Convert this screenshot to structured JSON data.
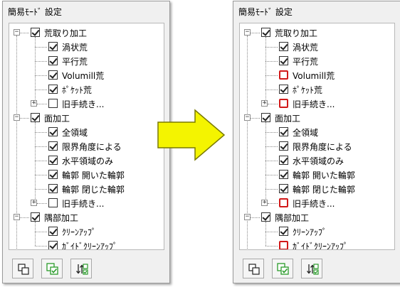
{
  "left_panel": {
    "title": "簡易ﾓｰﾄﾞ 設定",
    "groups": [
      {
        "label": "荒取り加工",
        "checked": true,
        "items": [
          {
            "label": "渦状荒",
            "checked": true
          },
          {
            "label": "平行荒",
            "checked": true
          },
          {
            "label": "Volumill荒",
            "checked": true
          },
          {
            "label": "ﾎﾟｹｯﾄ荒",
            "checked": true
          },
          {
            "label": "旧手続き...",
            "checked": false,
            "collapsed": true
          }
        ]
      },
      {
        "label": "面加工",
        "checked": true,
        "items": [
          {
            "label": "全領域",
            "checked": true
          },
          {
            "label": "限界角度による",
            "checked": true
          },
          {
            "label": "水平領域のみ",
            "checked": true
          },
          {
            "label": "輪郭 開いた輪郭",
            "checked": true
          },
          {
            "label": "輪郭 閉じた輪郭",
            "checked": true
          },
          {
            "label": "旧手続き...",
            "checked": false,
            "collapsed": true
          }
        ]
      },
      {
        "label": "隅部加工",
        "checked": true,
        "items": [
          {
            "label": "ｸﾘｰﾝｱｯﾌﾟ",
            "checked": true
          },
          {
            "label": "ｶﾞｲﾄﾞｸﾘｰﾝｱｯﾌﾟ",
            "checked": true
          }
        ]
      }
    ]
  },
  "right_panel": {
    "title": "簡易ﾓｰﾄﾞ 設定",
    "groups": [
      {
        "label": "荒取り加工",
        "checked": true,
        "items": [
          {
            "label": "渦状荒",
            "checked": true
          },
          {
            "label": "平行荒",
            "checked": true
          },
          {
            "label": "Volumill荒",
            "checked": false,
            "highlight": true
          },
          {
            "label": "ﾎﾟｹｯﾄ荒",
            "checked": true
          },
          {
            "label": "旧手続き...",
            "checked": false,
            "highlight": true,
            "collapsed": true
          }
        ]
      },
      {
        "label": "面加工",
        "checked": true,
        "items": [
          {
            "label": "全領域",
            "checked": true
          },
          {
            "label": "限界角度による",
            "checked": true
          },
          {
            "label": "水平領域のみ",
            "checked": true
          },
          {
            "label": "輪郭 開いた輪郭",
            "checked": true
          },
          {
            "label": "輪郭 閉じた輪郭",
            "checked": true
          },
          {
            "label": "旧手続き...",
            "checked": false,
            "highlight": true,
            "collapsed": true
          }
        ]
      },
      {
        "label": "隅部加工",
        "checked": true,
        "items": [
          {
            "label": "ｸﾘｰﾝｱｯﾌﾟ",
            "checked": true
          },
          {
            "label": "ｶﾞｲﾄﾞｸﾘｰﾝｱｯﾌﾟ",
            "checked": false,
            "highlight": true
          }
        ]
      }
    ]
  },
  "toolbar_icons": [
    "copy-icon",
    "check-all-icon",
    "swap-selection-icon"
  ],
  "colors": {
    "highlight": "#d11919",
    "arrow_fill": "#f4f400",
    "arrow_stroke": "#7a7a00",
    "icon_green": "#2a9a2a"
  }
}
